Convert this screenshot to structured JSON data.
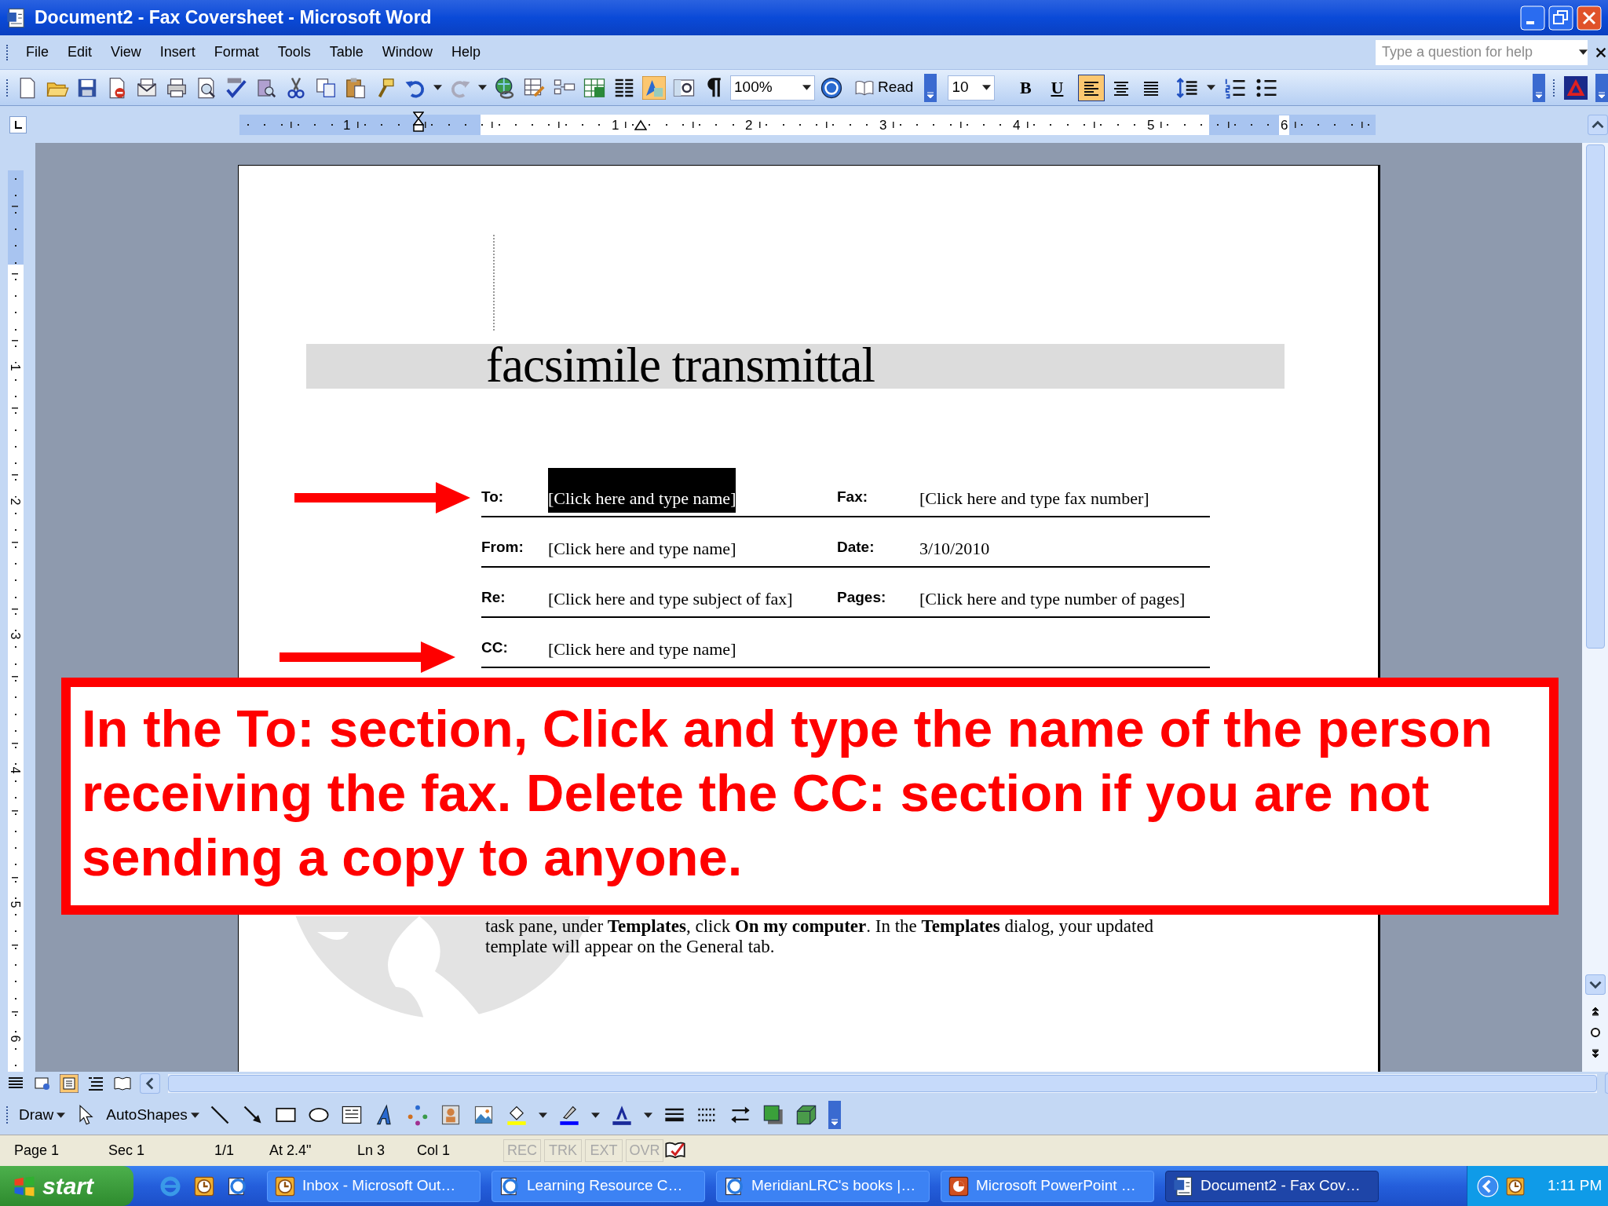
{
  "window": {
    "title": "Document2 - Fax Coversheet - Microsoft Word"
  },
  "menu": [
    "File",
    "Edit",
    "View",
    "Insert",
    "Format",
    "Tools",
    "Table",
    "Window",
    "Help"
  ],
  "help_search": {
    "placeholder": "Type a question for help"
  },
  "toolbar": {
    "zoom": "100%",
    "read_button": "Read",
    "font_size": "10",
    "bold": "B",
    "underline": "U",
    "align": [
      {
        "kind": "left",
        "selected": true
      },
      {
        "kind": "center",
        "selected": false
      },
      {
        "kind": "justify",
        "selected": false
      }
    ]
  },
  "ruler_labels": [
    "1",
    "1",
    "2",
    "3",
    "4",
    "5",
    "6"
  ],
  "vertical_ruler_labels": [
    "1",
    "2",
    "3",
    "4",
    "5",
    "6"
  ],
  "document": {
    "title": "facsimile transmittal",
    "rows": [
      [
        {
          "label": "To:",
          "value": "[Click here and type name]",
          "selected": true
        },
        {
          "label": "Fax:",
          "value": "[Click here and type fax number]",
          "selected": false
        }
      ],
      [
        {
          "label": "From:",
          "value": "[Click here and type name]",
          "selected": false
        },
        {
          "label": "Date:",
          "value": "3/10/2010",
          "selected": false
        }
      ],
      [
        {
          "label": "Re:",
          "value": "[Click here and type subject of fax]",
          "selected": false
        },
        {
          "label": "Pages:",
          "value": "[Click here and type number of pages]",
          "selected": false
        }
      ],
      [
        {
          "label": "CC:",
          "value": "[Click here and type name]",
          "selected": false
        }
      ]
    ],
    "body_lines": [
      "task pane, under **Templates**, click **On my computer**. In the **Templates** dialog, your updated",
      "template will appear on the General tab."
    ]
  },
  "callout": {
    "text": "In the To: section, Click and type the name of the person receiving the fax. Delete the CC: section if you are not sending a copy to anyone."
  },
  "draw_toolbar": {
    "draw": "Draw",
    "autoshapes": "AutoShapes"
  },
  "status_bar": [
    "Page 1",
    "Sec 1",
    "1/1",
    "At 2.4\"",
    "Ln 3",
    "Col 1"
  ],
  "status_modes": [
    {
      "label": "REC",
      "on": false
    },
    {
      "label": "TRK",
      "on": false
    },
    {
      "label": "EXT",
      "on": false
    },
    {
      "label": "OVR",
      "on": false
    }
  ],
  "taskbar": {
    "start": "start",
    "tasks": [
      {
        "label": "Inbox - Microsoft Out…",
        "kind": "outlook",
        "selected": false
      },
      {
        "label": "Learning Resource C…",
        "kind": "browser",
        "selected": false
      },
      {
        "label": "MeridianLRC's books |…",
        "kind": "browser",
        "selected": false
      },
      {
        "label": "Microsoft PowerPoint …",
        "kind": "powerpoint",
        "selected": false
      },
      {
        "label": "Document2 - Fax Cov…",
        "kind": "word",
        "selected": true
      }
    ],
    "clock": "1:11 PM"
  }
}
